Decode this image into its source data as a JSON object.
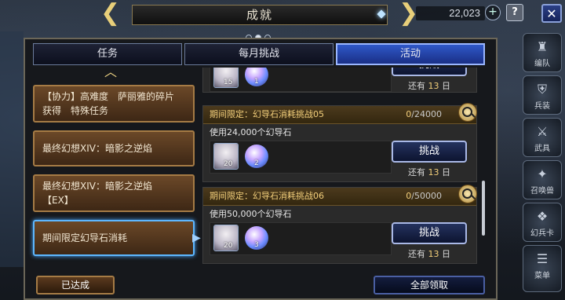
{
  "header": {
    "title": "成就",
    "currency": "22,023",
    "plus_symbol": "+",
    "help_symbol": "?",
    "close_symbol": "✕",
    "page_dots": 3,
    "active_dot": 2
  },
  "tabs": [
    {
      "label": "任务",
      "active": false
    },
    {
      "label": "每月挑战",
      "active": false
    },
    {
      "label": "活动",
      "active": true
    }
  ],
  "categories": [
    {
      "label": "【协力】高难度　萨丽雅的碎片\n获得　特殊任务",
      "selected": false
    },
    {
      "label": "最终幻想XIV：暗影之逆焰",
      "selected": false
    },
    {
      "label": "最终幻想XIV：暗影之逆焰\n【EX】",
      "selected": false
    },
    {
      "label": "期间限定幻导石消耗",
      "selected": true
    }
  ],
  "missions": [
    {
      "title": "",
      "progress_current": "",
      "progress_total": "",
      "description": "",
      "char_count": "15",
      "stone_count": "1",
      "button_label": "挑战",
      "remain_prefix": "还有",
      "remain_days": "13",
      "remain_suffix": "日"
    },
    {
      "title": "期间限定：幻导石消耗挑战05",
      "progress_current": "0",
      "progress_total": "/24000",
      "description": "使用24,000个幻导石",
      "char_count": "20",
      "stone_count": "2",
      "button_label": "挑战",
      "remain_prefix": "还有",
      "remain_days": "13",
      "remain_suffix": "日"
    },
    {
      "title": "期间限定：幻导石消耗挑战06",
      "progress_current": "0",
      "progress_total": "/50000",
      "description": "使用50,000个幻导石",
      "char_count": "20",
      "stone_count": "3",
      "button_label": "挑战",
      "remain_prefix": "还有",
      "remain_days": "13",
      "remain_suffix": "日"
    }
  ],
  "right_menu": [
    {
      "label": "编队",
      "icon": "party-icon"
    },
    {
      "label": "兵装",
      "icon": "armor-icon"
    },
    {
      "label": "武具",
      "icon": "weapon-icon"
    },
    {
      "label": "召唤兽",
      "icon": "summon-icon"
    },
    {
      "label": "幻兵卡",
      "icon": "card-icon"
    },
    {
      "label": "菜单",
      "icon": "menu-icon"
    }
  ],
  "footer": {
    "achieved_label": "已达成",
    "claim_all_label": "全部领取"
  },
  "colors": {
    "accent_gold": "#f3cf7b",
    "tab_active": "#2f58c8",
    "category_wood": "#6b4828"
  }
}
